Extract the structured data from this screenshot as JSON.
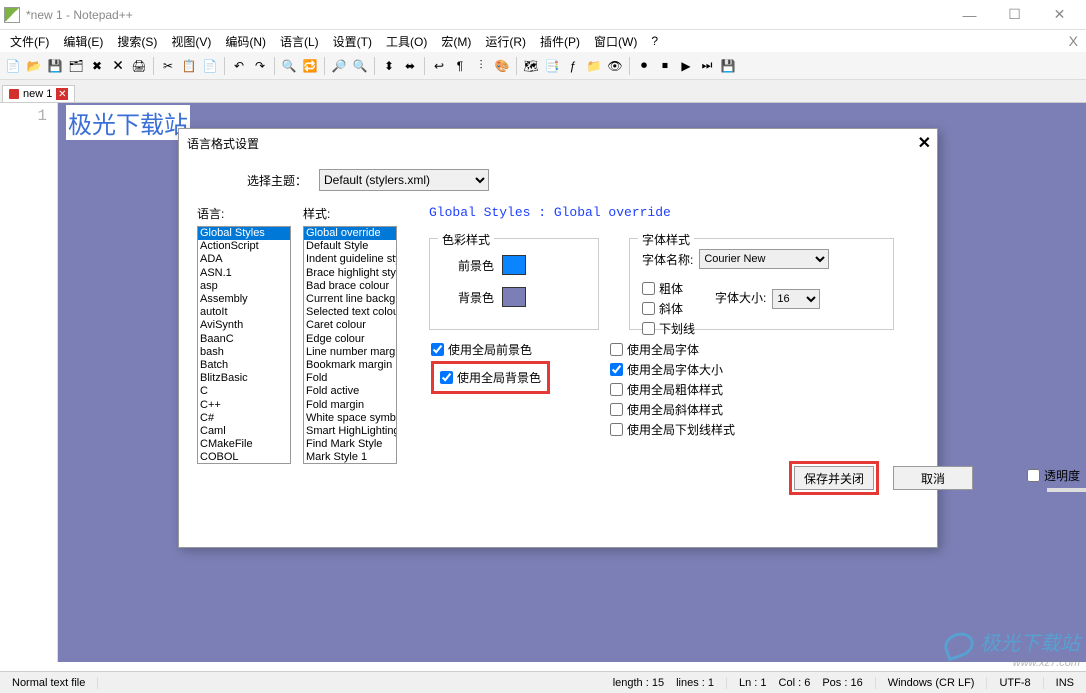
{
  "window": {
    "title": "*new 1 - Notepad++"
  },
  "menu": [
    "文件(F)",
    "编辑(E)",
    "搜索(S)",
    "视图(V)",
    "编码(N)",
    "语言(L)",
    "设置(T)",
    "工具(O)",
    "宏(M)",
    "运行(R)",
    "插件(P)",
    "窗口(W)",
    "?"
  ],
  "tab": {
    "name": "new 1"
  },
  "editor": {
    "line_number": "1",
    "text": "极光下载站"
  },
  "dialog": {
    "title": "语言格式设置",
    "theme_label": "选择主题：",
    "theme_value": "Default (stylers.xml)",
    "lang_label": "语言:",
    "style_label": "样式:",
    "lang_list": [
      "Global Styles",
      "ActionScript",
      "ADA",
      "ASN.1",
      "asp",
      "Assembly",
      "autoIt",
      "AviSynth",
      "BaanC",
      "bash",
      "Batch",
      "BlitzBasic",
      "C",
      "C++",
      "C#",
      "Caml",
      "CMakeFile",
      "COBOL"
    ],
    "lang_selected": "Global Styles",
    "style_list": [
      "Global override",
      "Default Style",
      "Indent guideline style",
      "Brace highlight style",
      "Bad brace colour",
      "Current line background",
      "Selected text colour",
      "Caret colour",
      "Edge colour",
      "Line number margin",
      "Bookmark margin",
      "Fold",
      "Fold active",
      "Fold margin",
      "White space symbol",
      "Smart HighLighting",
      "Find Mark Style",
      "Mark Style 1"
    ],
    "style_selected": "Global override",
    "gs_title": "Global Styles : Global override",
    "color_group": "色彩样式",
    "fg_label": "前景色",
    "bg_label": "背景色",
    "font_group": "字体样式",
    "font_name_label": "字体名称:",
    "font_name": "Courier New",
    "bold": "粗体",
    "italic": "斜体",
    "underline": "下划线",
    "font_size_label": "字体大小:",
    "font_size": "16",
    "global_fg": "使用全局前景色",
    "global_bg": "使用全局背景色",
    "global_font": "使用全局字体",
    "global_fontsize": "使用全局字体大小",
    "global_bold": "使用全局粗体样式",
    "global_italic": "使用全局斜体样式",
    "global_underline": "使用全局下划线样式",
    "save_close": "保存并关闭",
    "cancel": "取消",
    "transparency": "透明度"
  },
  "status": {
    "filetype": "Normal text file",
    "length": "length : 15",
    "lines": "lines : 1",
    "ln": "Ln : 1",
    "col": "Col : 6",
    "pos": "Pos : 16",
    "eol": "Windows (CR LF)",
    "encoding": "UTF-8",
    "ins": "INS"
  },
  "watermark": {
    "brand": "极光下载站",
    "url": "www.xz7.com"
  }
}
